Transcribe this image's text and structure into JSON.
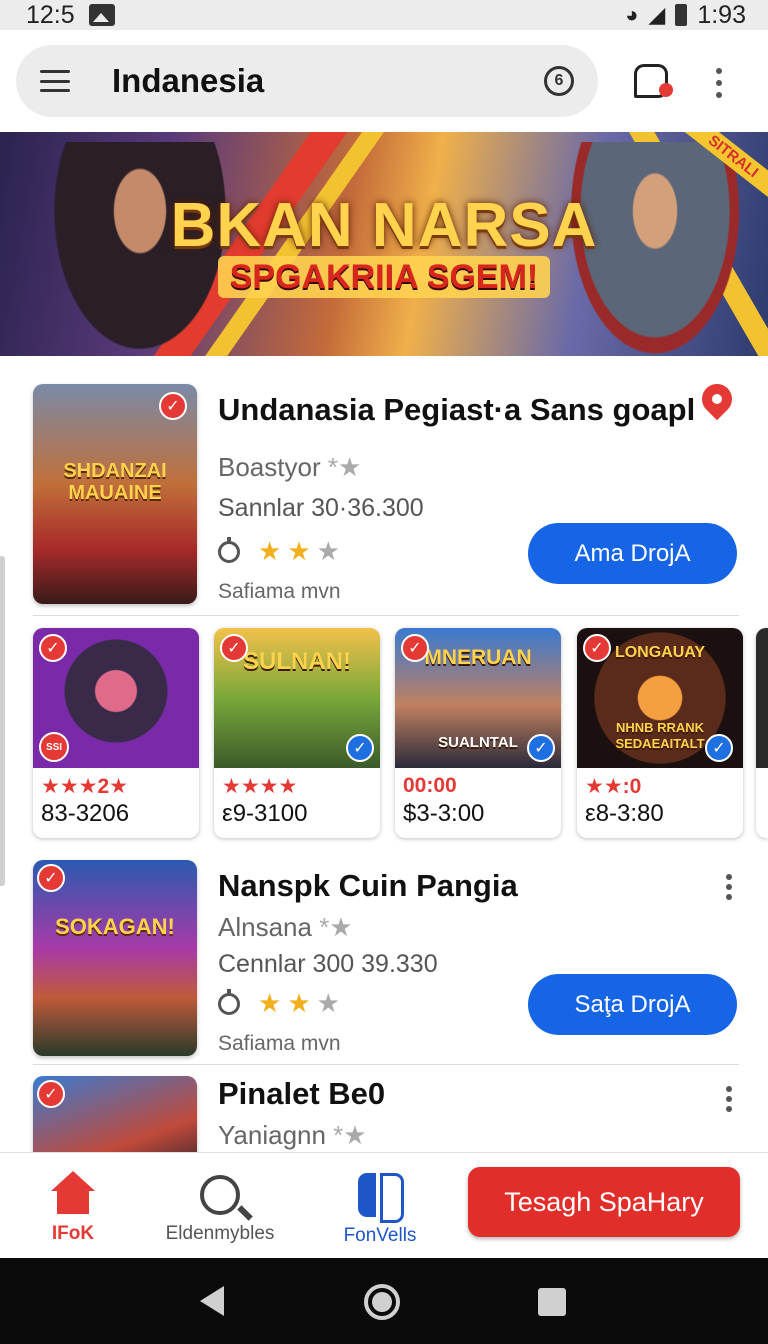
{
  "status_bar": {
    "time_left": "12:5",
    "time_right": "1:93"
  },
  "app_bar": {
    "title": "Indanesia",
    "coin_glyph": "6"
  },
  "banner": {
    "title": "BKAN NARSA",
    "subtitle": "SPGAKRIIA SGEM!",
    "corner_tag": "SITRALI"
  },
  "cards": [
    {
      "title": "Undanasia Pegiast·a Sans goapl",
      "developer": "Boastyor",
      "size": "Sannlar 30·36.300",
      "footer": "Safiama mvn",
      "button": "Ama DrojA",
      "thumb_text": "SHDANZAI MAUAINE"
    },
    {
      "title": "Nanspk Cuin Pangia",
      "developer": "Alnsana",
      "size": "Cennlar 300 39.330",
      "footer": "Safiama mvn",
      "button": "Saţa DrojA",
      "thumb_text": "SOKAGAN!"
    },
    {
      "title": "Pinalet Be0",
      "developer": "Yaniagnn"
    }
  ],
  "tiles": [
    {
      "art_text": "",
      "badge": "SSI",
      "rating": "★★★2★",
      "price": "83-3206"
    },
    {
      "art_text": "SULNAN!",
      "rating": "★★★★",
      "price": "ε9-3100"
    },
    {
      "art_text": "MNERUAN",
      "art_text2": "SUALNTAL",
      "rating": "00:00",
      "price": "$3-3:00"
    },
    {
      "art_text": "LONGAUAY",
      "art_text2": "NHNB RRANK SEDAEAITALT",
      "rating": "★★:0",
      "price": "ε8-3:80"
    }
  ],
  "bottom_nav": {
    "home_label": "IFoK",
    "search_label": "Eldenmybles",
    "games_label": "FonVells",
    "cta": "Tesagh SpaHary"
  },
  "colors": {
    "accent_blue": "#1565e6",
    "accent_red": "#e12e2a",
    "star_gold": "#f2b01e"
  }
}
